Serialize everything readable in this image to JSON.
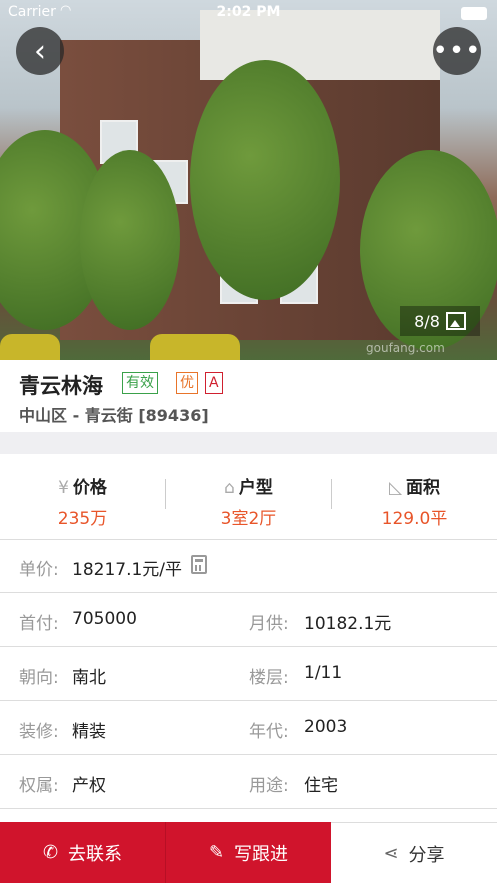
{
  "status_bar": {
    "carrier": "Carrier",
    "time": "2:02 PM"
  },
  "photo": {
    "counter": "8/8",
    "watermark": "goufang.com"
  },
  "listing": {
    "title": "青云林海",
    "tags": [
      "有效",
      "优",
      "A"
    ],
    "location": "中山区 - 青云街 [89436]"
  },
  "stats": [
    {
      "icon": "yen-icon",
      "glyph": "¥",
      "label": "价格",
      "value": "235万"
    },
    {
      "icon": "house-icon",
      "glyph": "⌂",
      "label": "户型",
      "value": "3室2厅"
    },
    {
      "icon": "area-icon",
      "glyph": "◺",
      "label": "面积",
      "value": "129.0平"
    }
  ],
  "details": {
    "unit_price": {
      "label": "单价:",
      "value": "18217.1元/平"
    },
    "rows": [
      {
        "left_label": "首付:",
        "left_value": "705000",
        "right_label": "月供:",
        "right_value": "10182.1元"
      },
      {
        "left_label": "朝向:",
        "left_value": "南北",
        "right_label": "楼层:",
        "right_value": "1/11"
      },
      {
        "left_label": "装修:",
        "left_value": "精装",
        "right_label": "年代:",
        "right_value": "2003"
      },
      {
        "left_label": "权属:",
        "left_value": "产权",
        "right_label": "用途:",
        "right_value": "住宅"
      }
    ]
  },
  "actions": {
    "contact": "去联系",
    "follow_up": "写跟进",
    "share": "分享"
  },
  "colors": {
    "accent": "#d0142c",
    "stat_value": "#e8552a",
    "tag_valid": "#3aa14a",
    "tag_good": "#e8742a",
    "tag_a": "#d0202f"
  }
}
